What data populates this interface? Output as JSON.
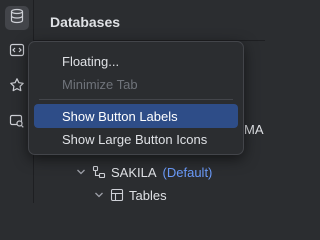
{
  "toolstrip": {
    "items": [
      {
        "icon": "database-icon"
      },
      {
        "icon": "code-icon"
      },
      {
        "icon": "star-icon"
      },
      {
        "icon": "search-icon"
      }
    ]
  },
  "panel": {
    "title": "Databases"
  },
  "tree": {
    "truncated_text": "MA",
    "schema_label": "SAKILA",
    "schema_tag": "(Default)",
    "folder_label": "Tables"
  },
  "context_menu": {
    "items": [
      {
        "label": "Floating...",
        "enabled": true,
        "highlighted": false
      },
      {
        "label": "Minimize Tab",
        "enabled": false,
        "highlighted": false
      },
      {
        "label": "Show Button Labels",
        "enabled": true,
        "highlighted": true
      },
      {
        "label": "Show Large Button Icons",
        "enabled": true,
        "highlighted": false
      }
    ]
  },
  "colors": {
    "background": "#2b2d30",
    "selection": "#2e4d88",
    "accent_tag": "#6b9bfa"
  }
}
